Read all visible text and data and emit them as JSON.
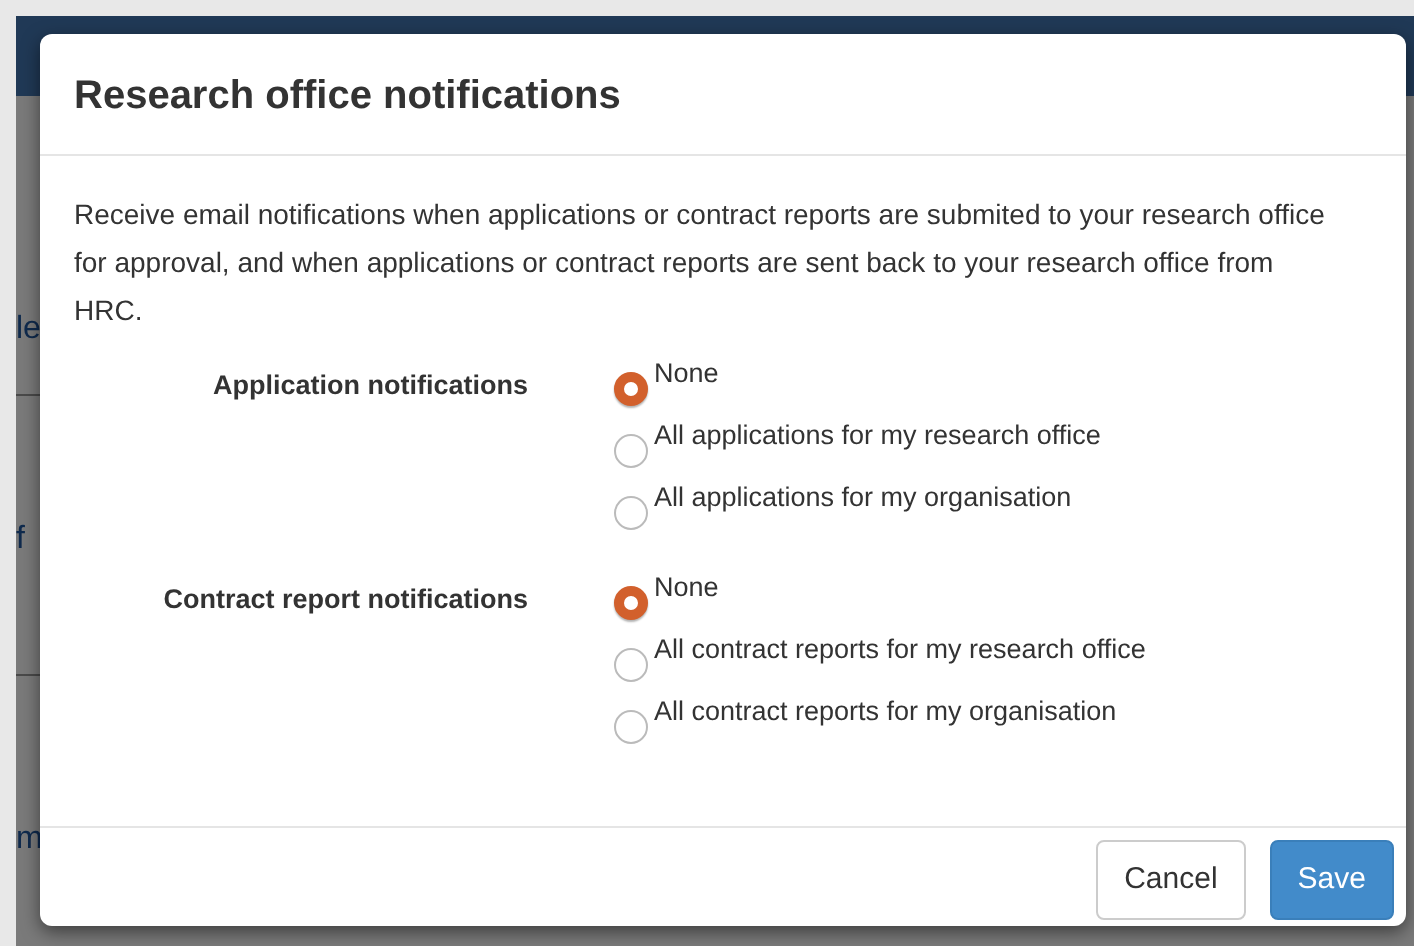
{
  "background": {
    "fragments": [
      "le",
      "f",
      "m"
    ]
  },
  "modal": {
    "title": "Research office notifications",
    "description": "Receive email notifications when applications or contract reports are submited to your research office for approval, and when applications or contract reports are sent back to your research office from HRC.",
    "groups": [
      {
        "label": "Application notifications",
        "options": [
          {
            "label": "None",
            "selected": true
          },
          {
            "label": "All applications for my research office",
            "selected": false
          },
          {
            "label": "All applications for my organisation",
            "selected": false
          }
        ]
      },
      {
        "label": "Contract report notifications",
        "options": [
          {
            "label": "None",
            "selected": true
          },
          {
            "label": "All contract reports for my research office",
            "selected": false
          },
          {
            "label": "All contract reports for my organisation",
            "selected": false
          }
        ]
      }
    ],
    "buttons": [
      {
        "label": "Cancel",
        "kind": "secondary"
      },
      {
        "label": "Save",
        "kind": "primary"
      }
    ]
  }
}
